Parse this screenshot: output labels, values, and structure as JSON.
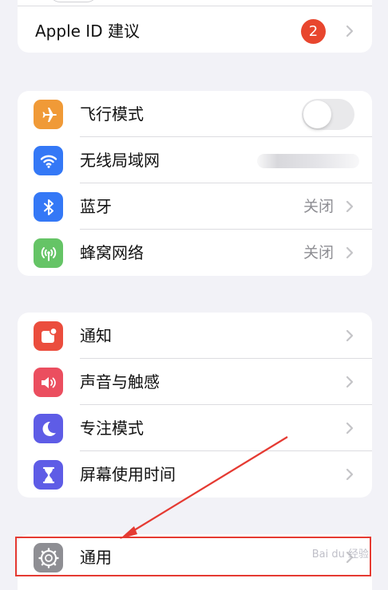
{
  "apple_id_row": {
    "label": "Apple ID 建议",
    "badge": "2"
  },
  "connectivity": {
    "airplane": {
      "label": "飞行模式",
      "icon": "airplane-icon",
      "color": "#f09a37",
      "toggle_on": false
    },
    "wifi": {
      "label": "无线局域网",
      "icon": "wifi-icon",
      "color": "#3478f6"
    },
    "bluetooth": {
      "label": "蓝牙",
      "value": "关闭",
      "icon": "bluetooth-icon",
      "color": "#3478f6"
    },
    "cellular": {
      "label": "蜂窝网络",
      "value": "关闭",
      "icon": "antenna-icon",
      "color": "#65c466"
    }
  },
  "notifications_group": {
    "notifications": {
      "label": "通知",
      "icon": "bell-icon",
      "color": "#eb4d3d"
    },
    "sounds": {
      "label": "声音与触感",
      "icon": "speaker-icon",
      "color": "#eb4e5f"
    },
    "focus": {
      "label": "专注模式",
      "icon": "moon-icon",
      "color": "#5e5ce6"
    },
    "screen_time": {
      "label": "屏幕使用时间",
      "icon": "hourglass-icon",
      "color": "#5e5ce6"
    }
  },
  "general_group": {
    "general": {
      "label": "通用",
      "icon": "gear-icon",
      "color": "#8e8e93"
    }
  },
  "watermark": "Bai du 经验"
}
